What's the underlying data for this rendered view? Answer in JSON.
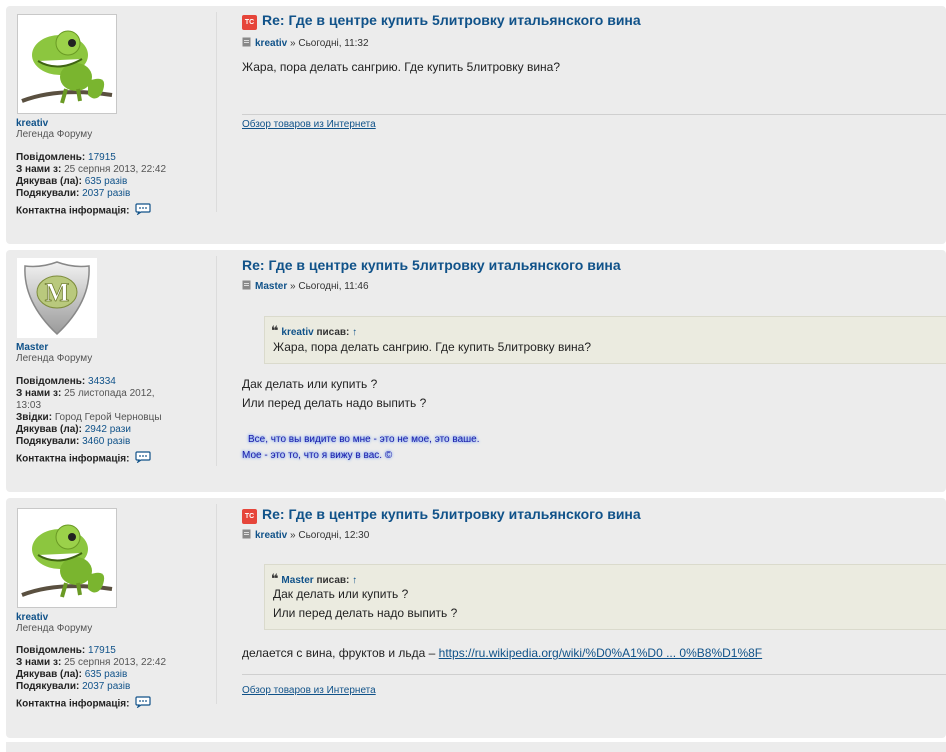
{
  "posts": [
    {
      "author": {
        "name": "kreativ",
        "rank": "Легенда Форуму",
        "avatar": "chameleon-avatar",
        "posts_label": "Повідомлень:",
        "posts": "17915",
        "joined_label": "З нами з:",
        "joined": "25 серпня 2013, 22:42",
        "thanked_label": "Дякував (ла):",
        "thanked": "635 разів",
        "thanks_label": "Подякували:",
        "thanks": "2037 разів",
        "contact_label": "Контактна інформація:"
      },
      "title": "Re: Где в центре купить 5литровку итальянского вина",
      "author_link": "kreativ",
      "time": "» Сьогодні, 11:32",
      "body": "Жара, пора делать сангрию. Где купить 5литровку вина?",
      "signature": "Обзор товаров из Интернета"
    },
    {
      "author": {
        "name": "Master",
        "rank": "Легенда Форуму",
        "avatar": "master-shield-avatar",
        "posts_label": "Повідомлень:",
        "posts": "34334",
        "joined_label": "З нами з:",
        "joined": "25 листопада 2012,",
        "joined2": "13:03",
        "from_label": "Звідки:",
        "from": "Город Герой Черновцы",
        "thanked_label": "Дякував (ла):",
        "thanked": "2942 рази",
        "thanks_label": "Подякували:",
        "thanks": "3460 разів",
        "contact_label": "Контактна інформація:"
      },
      "title": "Re: Где в центре купить 5литровку итальянского вина",
      "author_link": "Master",
      "time": "» Сьогодні, 11:46",
      "quote": {
        "author": "kreativ",
        "wrote": "писав:",
        "arrow": "↑",
        "lines": [
          "Жара, пора делать сангрию. Где купить 5литровку вина?"
        ]
      },
      "body_lines": [
        "Дак делать или купить ?",
        "Или перед делать надо выпить ?"
      ],
      "signature_lines": [
        "Все, что вы видите во мне - это не мое, это ваше.",
        "Мое - это то, что я вижу в вас. ©"
      ]
    },
    {
      "author": {
        "name": "kreativ",
        "rank": "Легенда Форуму",
        "avatar": "chameleon-avatar",
        "posts_label": "Повідомлень:",
        "posts": "17915",
        "joined_label": "З нами з:",
        "joined": "25 серпня 2013, 22:42",
        "thanked_label": "Дякував (ла):",
        "thanked": "635 разів",
        "thanks_label": "Подякували:",
        "thanks": "2037 разів",
        "contact_label": "Контактна інформація:"
      },
      "title": "Re: Где в центре купить 5литровку итальянского вина",
      "author_link": "kreativ",
      "time": "» Сьогодні, 12:30",
      "quote": {
        "author": "Master",
        "wrote": "писав:",
        "arrow": "↑",
        "lines": [
          "Дак делать или купить ?",
          "Или перед делать надо выпить ?"
        ]
      },
      "body_text": "делается с вина, фруктов и льда –",
      "body_link": "https://ru.wikipedia.org/wiki/%D0%A1%D0 ... 0%B8%D1%8F",
      "signature": "Обзор товаров из Интернета"
    }
  ],
  "colors": {
    "link": "#105289",
    "post_bg": "#ececec",
    "badge": "#e6453a"
  }
}
